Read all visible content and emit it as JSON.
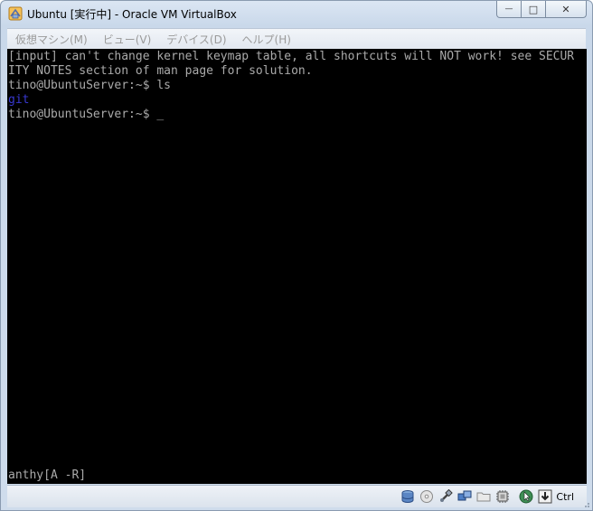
{
  "window": {
    "title": "Ubuntu [実行中] - Oracle VM VirtualBox",
    "caption": {
      "minimize": "—",
      "maximize": "□",
      "close": "✕"
    }
  },
  "menu": {
    "items": [
      {
        "label": "仮想マシン(M)"
      },
      {
        "label": "ビュー(V)"
      },
      {
        "label": "デバイス(D)"
      },
      {
        "label": "ヘルプ(H)"
      }
    ]
  },
  "terminal": {
    "lines": [
      "[input] can't change kernel keymap table, all shortcuts will NOT work! see SECUR",
      "ITY NOTES section of man page for solution.",
      "tino@UbuntuServer:~$ ls",
      "git",
      "tino@UbuntuServer:~$ ",
      "anthy[A -R]"
    ],
    "cursor": "_",
    "colors": {
      "text": "#aaaaaa",
      "directory": "#3838d0",
      "background": "#000000"
    }
  },
  "statusbar": {
    "icons": [
      "hard-disk-icon",
      "optical-drive-icon",
      "usb-icon",
      "network-icon",
      "shared-folder-icon",
      "cpu-virtualization-icon",
      "mouse-integration-icon",
      "host-key-icon"
    ],
    "host_key": "Ctrl"
  }
}
